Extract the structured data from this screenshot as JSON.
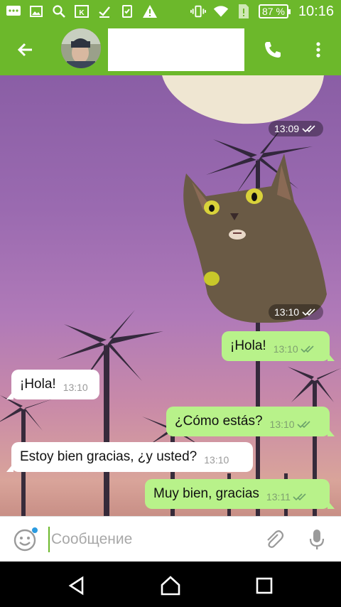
{
  "status_bar": {
    "battery_label": "87 %",
    "time": "10:16",
    "icons": [
      "message-icon",
      "image-icon",
      "search-icon",
      "vk-icon",
      "download-icon",
      "clipboard-icon",
      "warning-icon",
      "vibrate-icon",
      "wifi-icon",
      "no-sim-icon",
      "battery-icon"
    ]
  },
  "toolbar": {
    "title": "",
    "back_icon": "arrow-left-icon",
    "call_icon": "phone-icon",
    "menu_icon": "more-vert-icon"
  },
  "messages": [
    {
      "type": "sticker",
      "content": "cropped-sticker",
      "time": "13:09",
      "status": "read"
    },
    {
      "type": "sticker",
      "content": "cat-sticker",
      "time": "13:10",
      "status": "read"
    },
    {
      "type": "outgoing",
      "text": "¡Hola!",
      "time": "13:10",
      "status": "read"
    },
    {
      "type": "incoming",
      "text": "¡Hola!",
      "time": "13:10"
    },
    {
      "type": "outgoing",
      "text": "¿Cómo estás?",
      "time": "13:10",
      "status": "read"
    },
    {
      "type": "incoming",
      "text": "Estoy bien gracias, ¿y usted?",
      "time": "13:10"
    },
    {
      "type": "outgoing",
      "text": "Muy bien, gracias",
      "time": "13:11",
      "status": "read"
    }
  ],
  "input": {
    "value": "",
    "placeholder": "Сообщение"
  },
  "colors": {
    "accent": "#6cb82b",
    "outgoing_bubble": "#b8f28a",
    "incoming_bubble": "#ffffff",
    "read_checks": "#6ca36a"
  }
}
